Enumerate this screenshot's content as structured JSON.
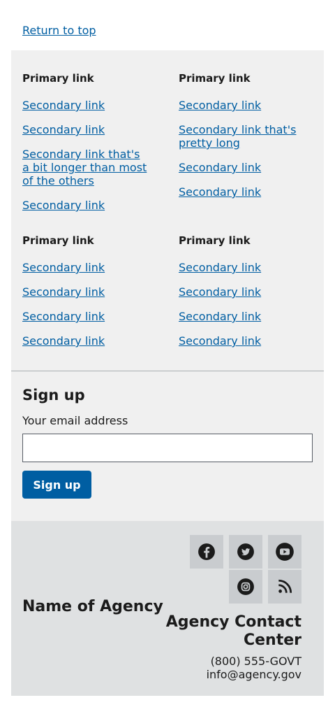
{
  "return_to_top": "Return to top",
  "link_sections": [
    {
      "primary": "Primary link",
      "secondary": [
        "Secondary link",
        "Secondary link",
        "Secondary link that's a bit longer than most of the others",
        "Secondary link"
      ]
    },
    {
      "primary": "Primary link",
      "secondary": [
        "Secondary link",
        "Secondary link that's pretty long",
        "Secondary link",
        "Secondary link"
      ]
    },
    {
      "primary": "Primary link",
      "secondary": [
        "Secondary link",
        "Secondary link",
        "Secondary link",
        "Secondary link"
      ]
    },
    {
      "primary": "Primary link",
      "secondary": [
        "Secondary link",
        "Secondary link",
        "Secondary link",
        "Secondary link"
      ]
    }
  ],
  "signup": {
    "heading": "Sign up",
    "email_label": "Your email address",
    "email_value": "",
    "button_label": "Sign up"
  },
  "agency": {
    "name": "Name of Agency",
    "contact_heading": "Agency Contact Center",
    "phone": "(800) 555-GOVT",
    "email": "info@agency.gov"
  },
  "social_icons": [
    "facebook-icon",
    "twitter-icon",
    "youtube-icon",
    "instagram-icon",
    "rss-icon"
  ],
  "colors": {
    "link": "#005ea2",
    "panel": "#f0f0f0",
    "agency_panel": "#dfe1e2",
    "social_bg": "#c9cccf",
    "button": "#005ea2"
  }
}
